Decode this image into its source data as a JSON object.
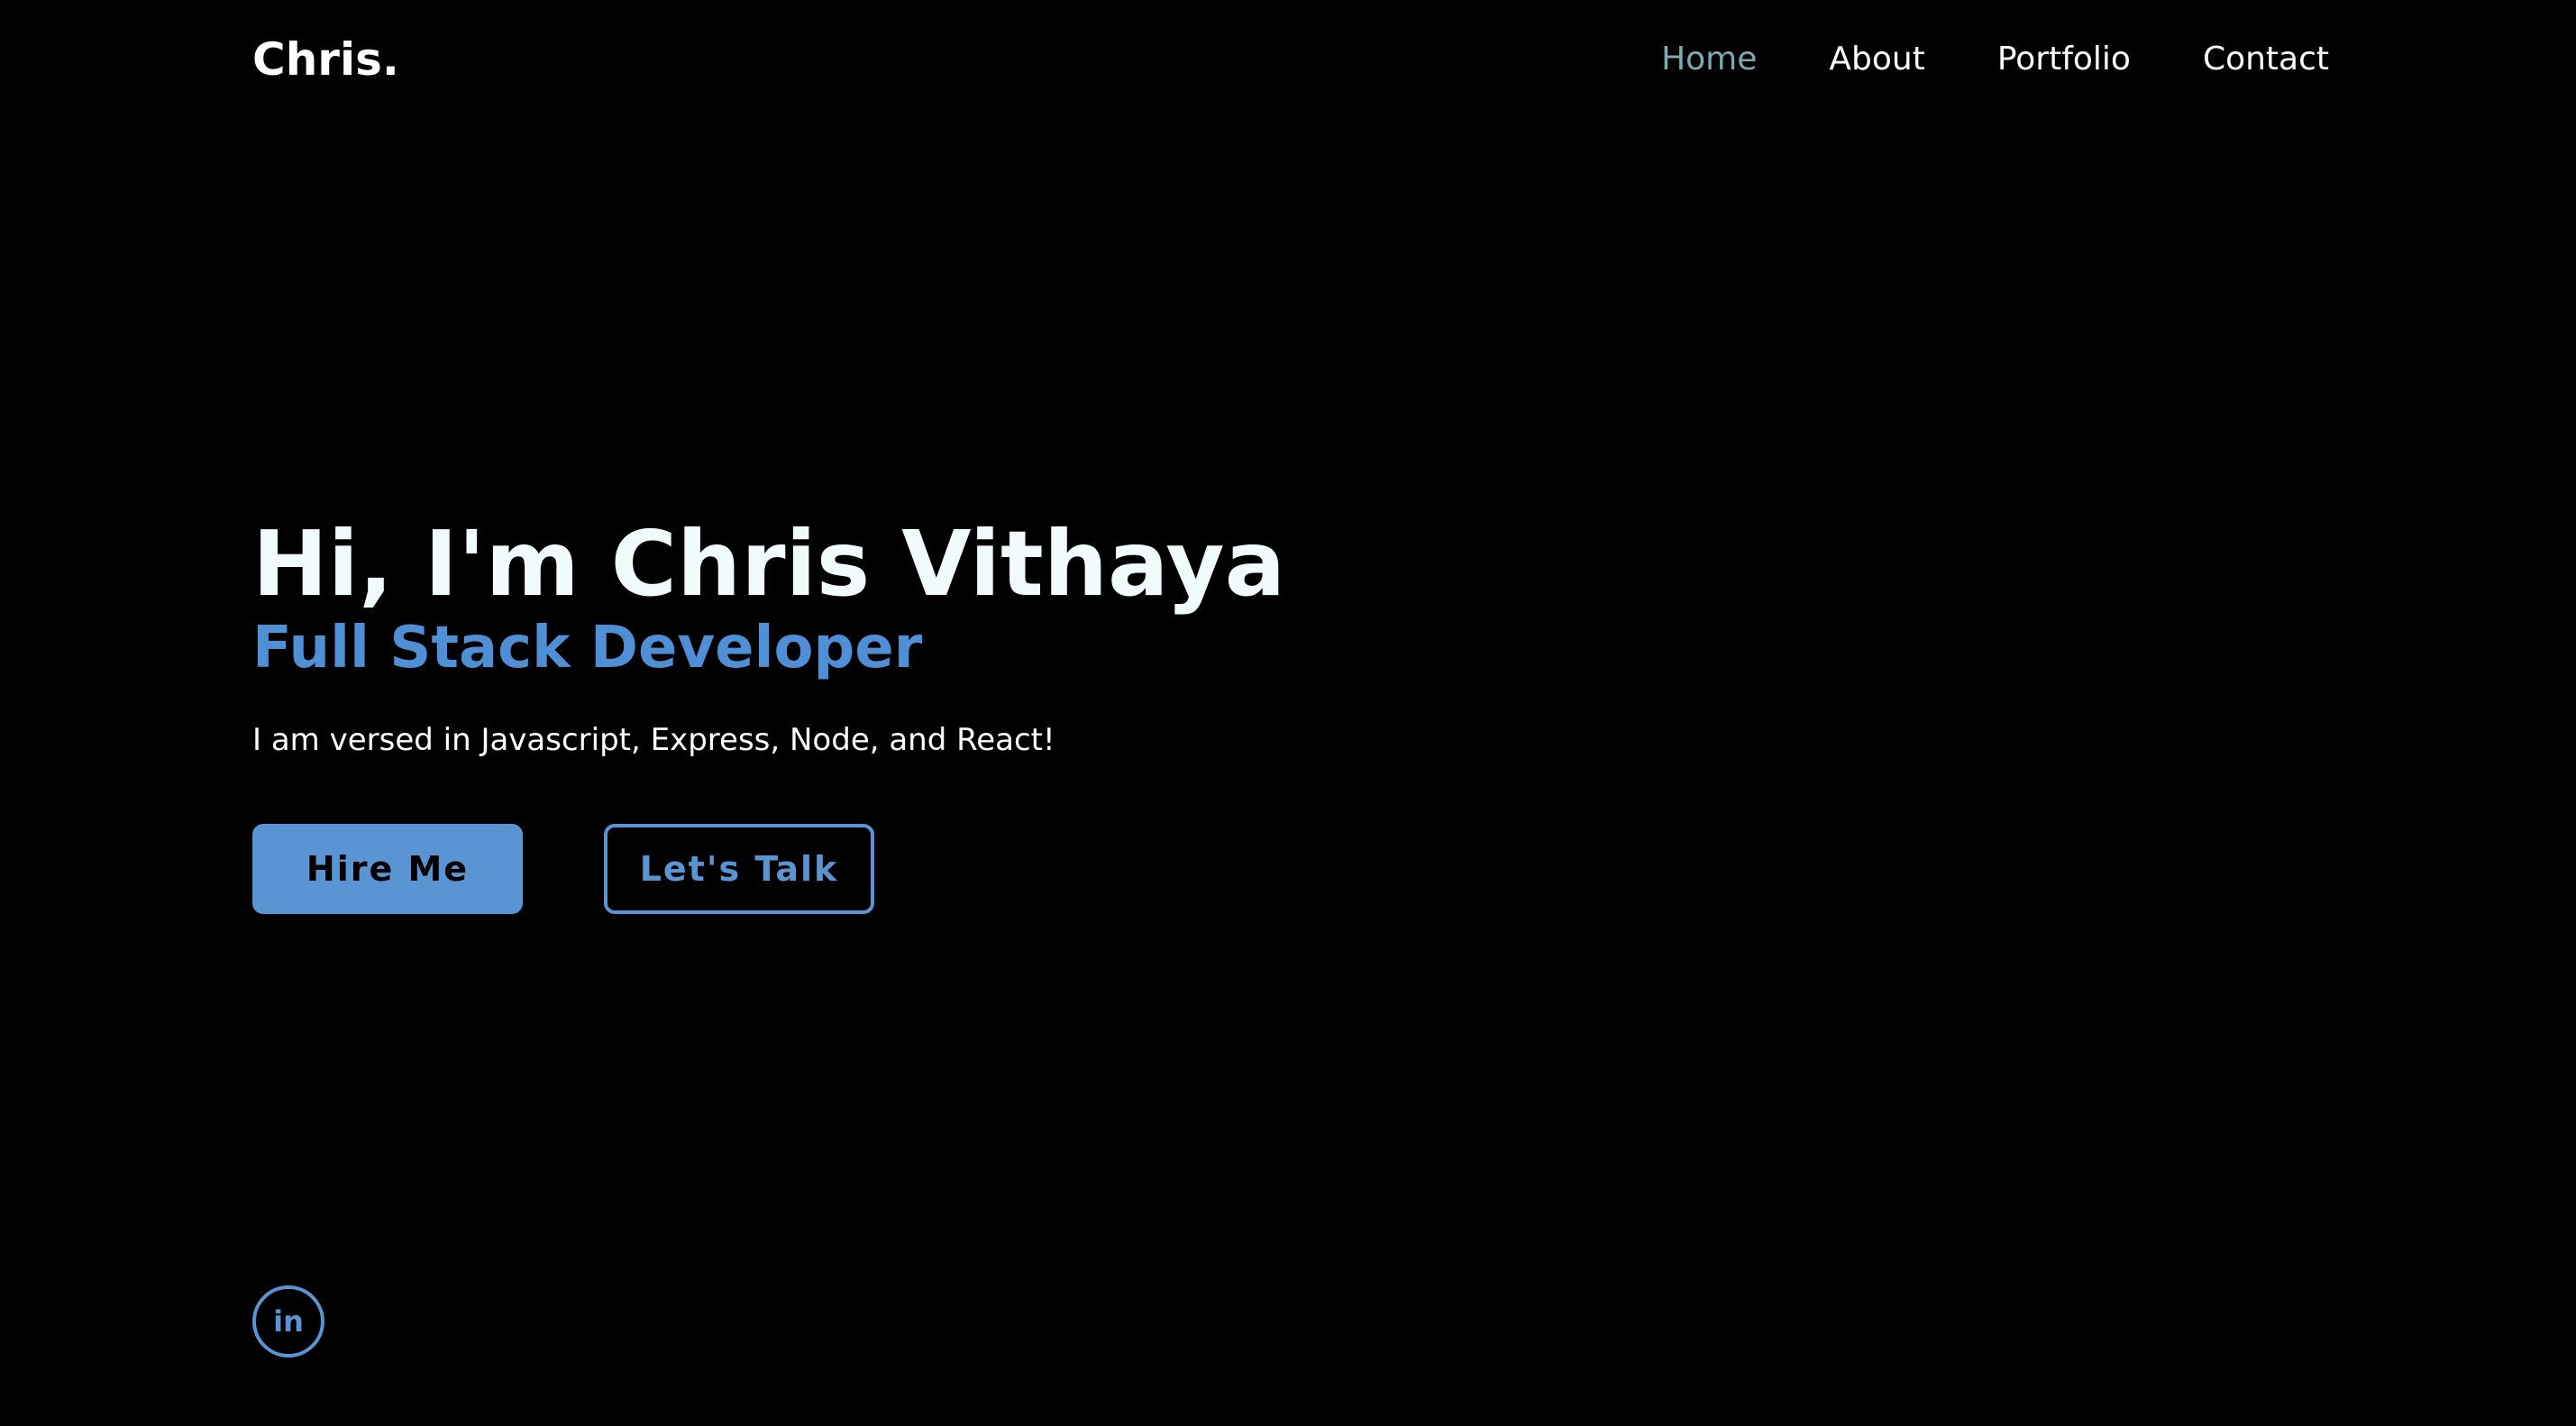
{
  "header": {
    "logo": "Chris.",
    "nav": [
      {
        "label": "Home",
        "active": true
      },
      {
        "label": "About",
        "active": false
      },
      {
        "label": "Portfolio",
        "active": false
      },
      {
        "label": "Contact",
        "active": false
      }
    ]
  },
  "hero": {
    "title": "Hi, I'm Chris Vithaya",
    "subtitle": "Full Stack Developer",
    "description": "I am versed in Javascript, Express, Node, and React!"
  },
  "buttons": {
    "hire_label": "Hire Me",
    "talk_label": "Let's Talk"
  },
  "social": {
    "linkedin_glyph": "in",
    "linkedin_icon": "linkedin-icon"
  },
  "colors": {
    "background": "#000000",
    "accent": "#5a94d3",
    "nav_active": "#7da9b3",
    "title": "#f2fbfc"
  }
}
